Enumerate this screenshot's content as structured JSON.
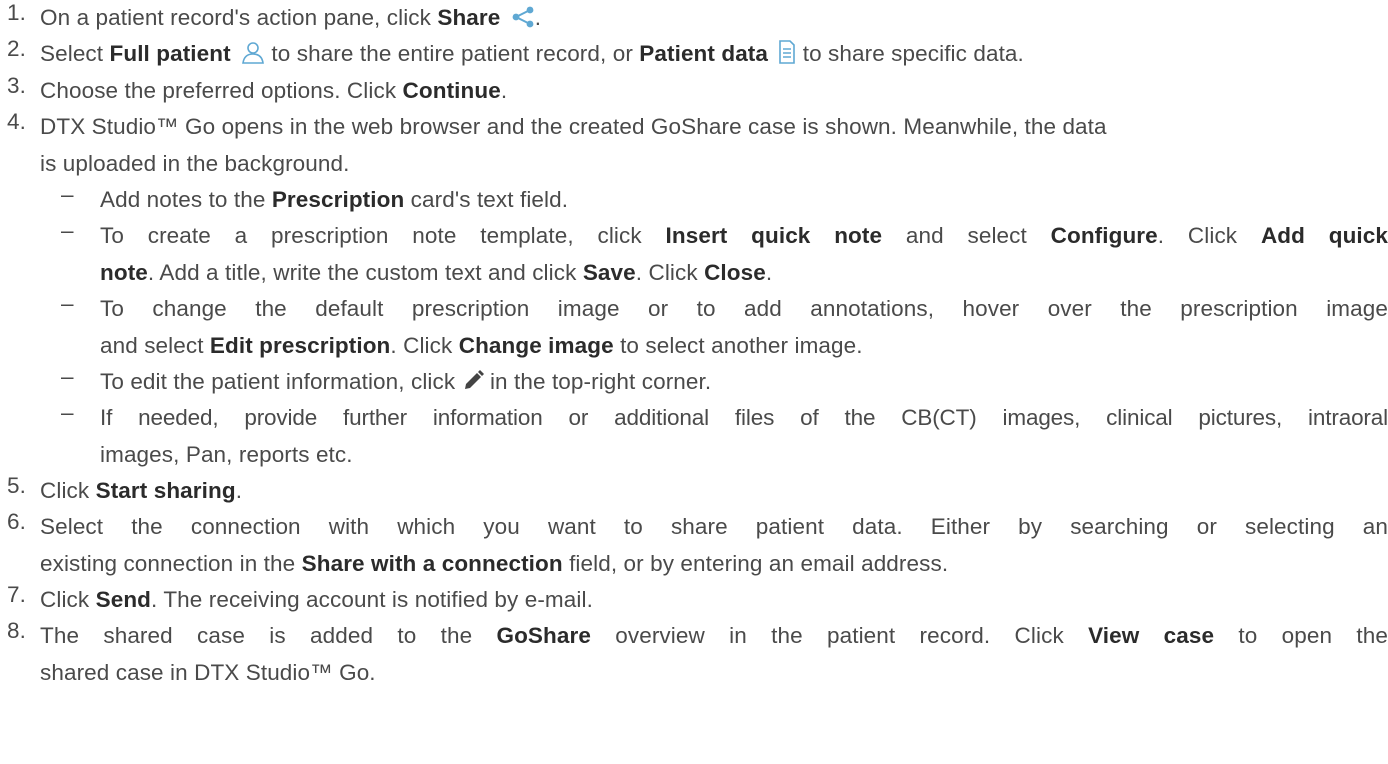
{
  "colors": {
    "text": "#4a4a4a",
    "bold": "#2b2b2b",
    "accent": "#5fa8d3",
    "pencil": "#444444"
  },
  "steps": [
    {
      "n": "1.",
      "a": "On a patient record's action pane, click ",
      "b": "Share",
      "c": "."
    },
    {
      "n": "2.",
      "a": "Select ",
      "b1": "Full patient",
      "m": " to share the entire patient record, or ",
      "b2": "Patient data",
      "e": " to share specific data."
    },
    {
      "n": "3.",
      "a": "Choose the preferred options. Click ",
      "b": "Continue",
      "c": "."
    },
    {
      "n": "4.",
      "line1": "DTX Studio™ Go opens in the web browser and the created GoShare case is shown. Meanwhile, the data",
      "line2": "is uploaded in the background."
    },
    {
      "n": "5.",
      "a": "Click ",
      "b": "Start sharing",
      "c": "."
    },
    {
      "n": "6.",
      "line1": "Select the connection with which you want to share patient data. Either by searching or selecting an",
      "a": "existing connection in the ",
      "b": "Share with a connection",
      "c": " field, or by entering an email address."
    },
    {
      "n": "7.",
      "a": "Click ",
      "b": "Send",
      "c": ". The receiving account is notified by e-mail."
    },
    {
      "n": "8.",
      "a": "The shared case is added to the ",
      "b": "GoShare",
      "m": " overview in the patient record. Click ",
      "b2": "View case",
      "e": " to open the",
      "line2": "shared case in DTX Studio™ Go."
    }
  ],
  "sub": [
    {
      "a": "Add notes to the ",
      "b": "Prescription",
      "c": " card's text field."
    },
    {
      "a": "To create a prescription note template, click ",
      "b1": "Insert quick note",
      "m1": " and select ",
      "b2": "Configure",
      "m2": ". Click ",
      "b3": "Add quick",
      "b4": "note",
      "m3": ". Add a title, write the custom text and click ",
      "b5": "Save",
      "m4": ". Click ",
      "b6": "Close",
      "e": "."
    },
    {
      "line1": "To change the default prescription image or to add annotations, hover over the prescription image",
      "a": "and select ",
      "b1": "Edit prescription",
      "m": ". Click ",
      "b2": "Change image",
      "e": " to select another image."
    },
    {
      "a": "To edit the patient information, click ",
      "e": " in the top-right corner."
    },
    {
      "line1": "If needed, provide further information or additional files of the CB(CT) images, clinical pictures, intraoral",
      "line2": "images, Pan, reports etc."
    }
  ],
  "dash": "–"
}
